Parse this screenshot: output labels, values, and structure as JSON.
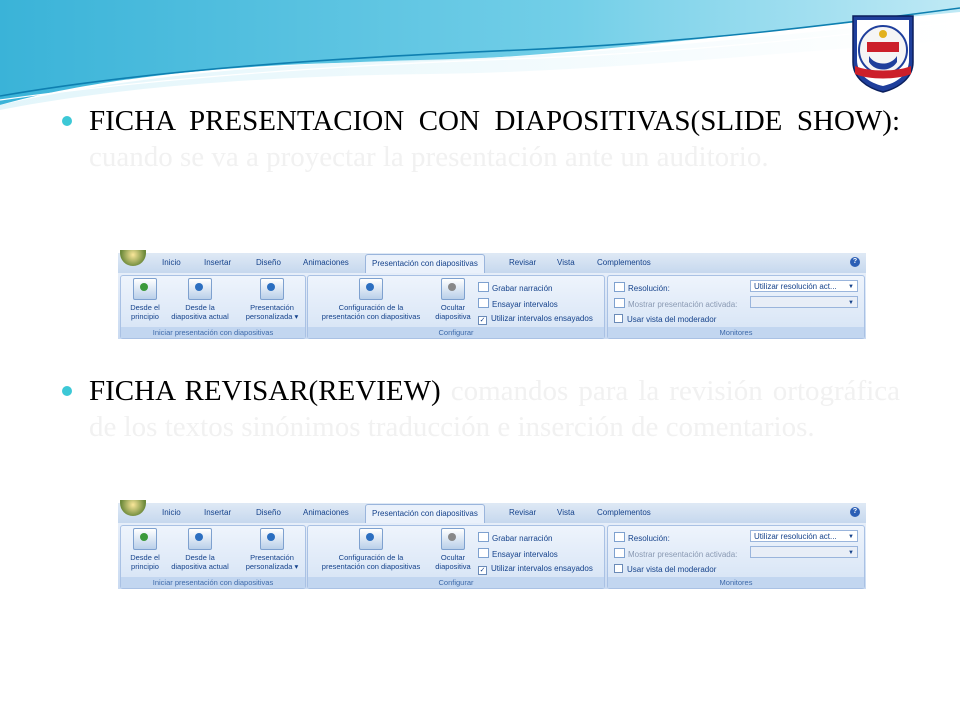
{
  "bullets": [
    {
      "lead": "FICHA PRESENTACION CON DIAPOSITIVAS(SLIDE SHOW):",
      "rest": " cuando se va a proyectar la presentación ante un auditorio."
    },
    {
      "lead": "FICHA REVISAR(REVIEW)",
      "rest": " comandos para la revisión ortográfica de los textos sinónimos traducción e inserción de comentarios."
    }
  ],
  "ribbon": {
    "tabs": [
      "Inicio",
      "Insertar",
      "Diseño",
      "Animaciones",
      "Presentación con diapositivas",
      "Revisar",
      "Vista",
      "Complementos"
    ],
    "active_tab": "Presentación con diapositivas",
    "help_glyph": "?",
    "groups": {
      "iniciar": {
        "label": "Iniciar presentación con diapositivas",
        "desde_principio": [
          "Desde el",
          "principio"
        ],
        "desde_actual": [
          "Desde la",
          "diapositiva actual"
        ],
        "personalizada": [
          "Presentación",
          "personalizada ▾"
        ]
      },
      "configurar": {
        "label": "Configurar",
        "configuracion": [
          "Configuración de la",
          "presentación con diapositivas"
        ],
        "ocultar": [
          "Ocultar",
          "diapositiva"
        ],
        "grabar": "Grabar narración",
        "ensayar": "Ensayar intervalos",
        "utilizar": "Utilizar intervalos ensayados",
        "check_mark": "✓"
      },
      "monitores": {
        "label": "Monitores",
        "resolucion": "Resolución:",
        "resolucion_value": "Utilizar resolución act...",
        "mostrar": "Mostrar presentación activada:",
        "moderador": "Usar vista del moderador",
        "arrow": "▼"
      }
    }
  },
  "colors": {
    "bullet": "#3cc8d6",
    "ribbon_text": "#15428b",
    "wave_dark": "#1aa6c9",
    "wave_light": "#bfe9f5"
  }
}
